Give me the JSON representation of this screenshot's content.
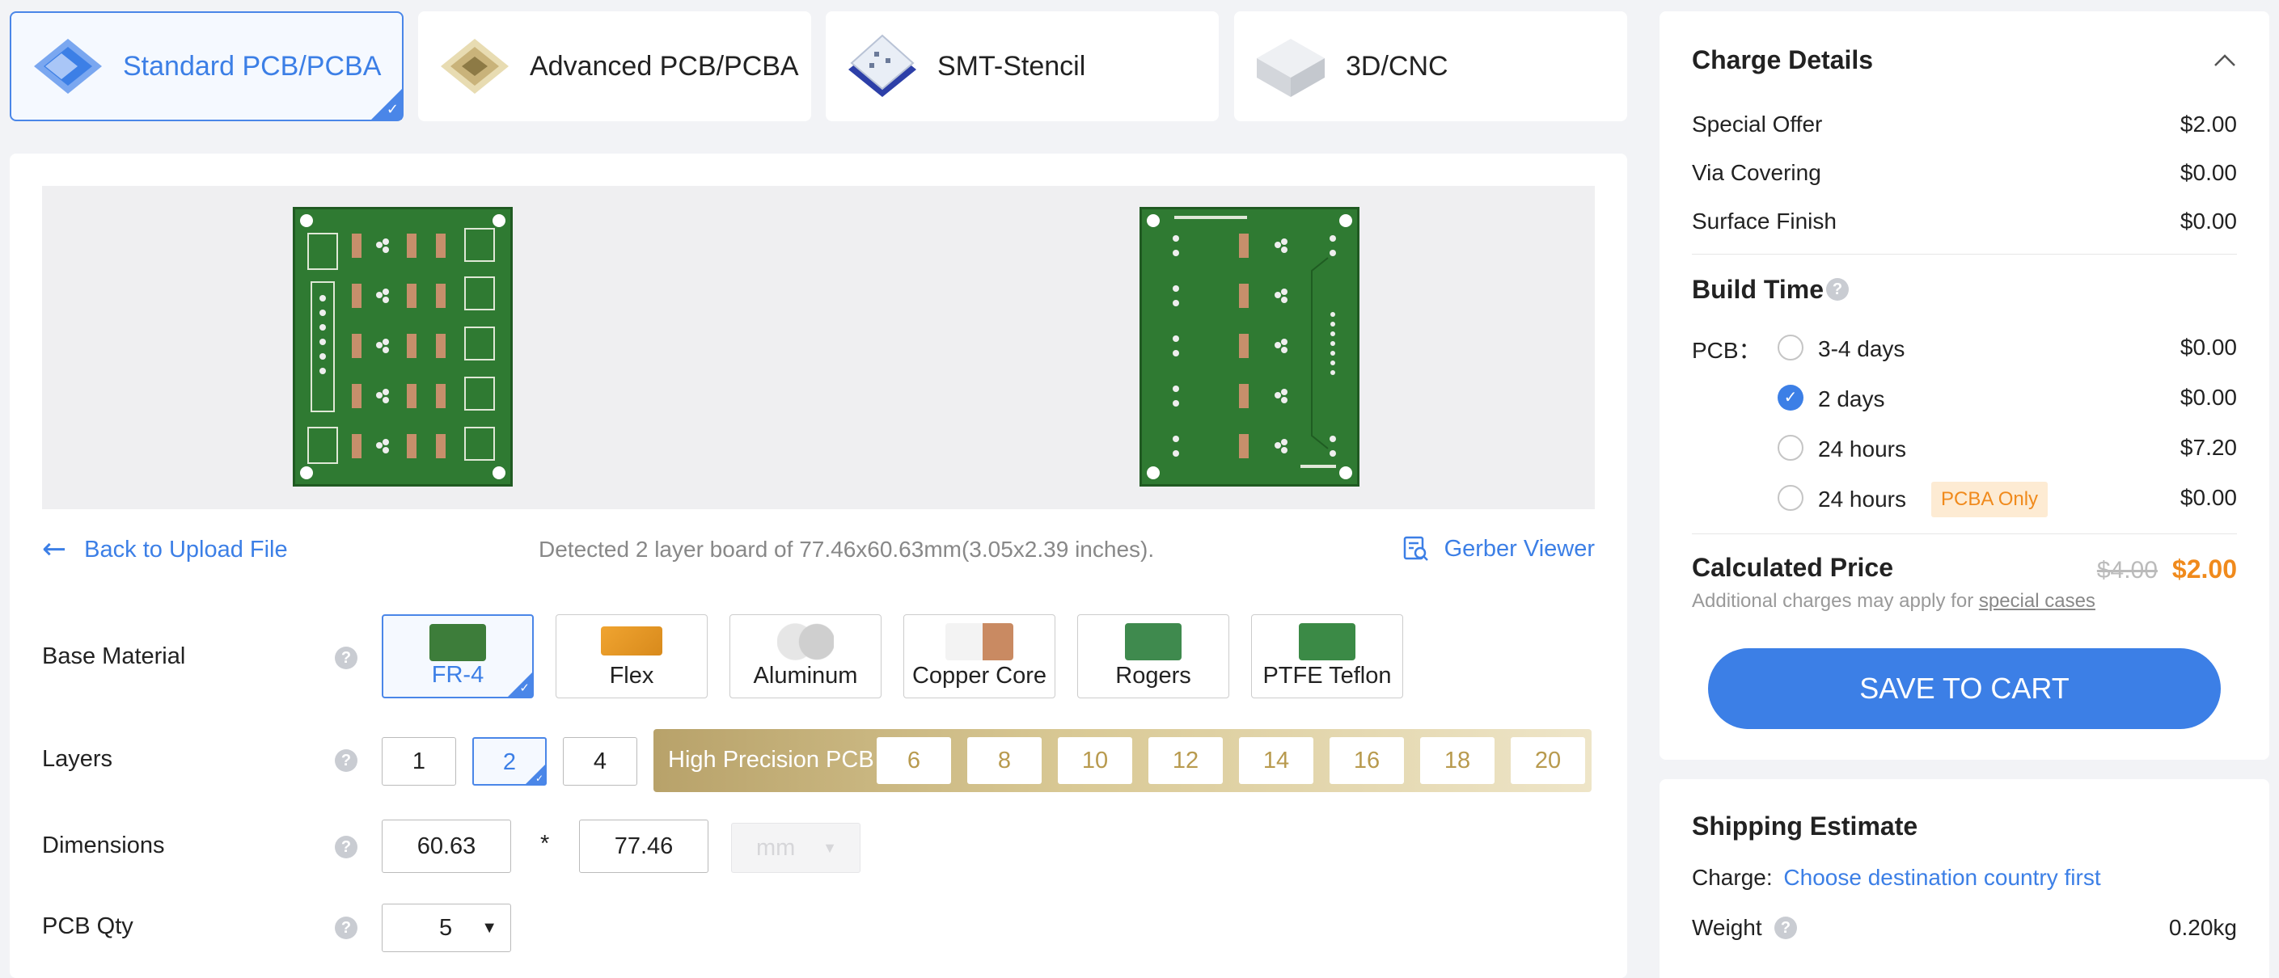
{
  "tabs": [
    {
      "label": "Standard PCB/PCBA",
      "icon": "standard-pcb-icon",
      "active": true
    },
    {
      "label": "Advanced PCB/PCBA",
      "icon": "advanced-pcb-icon",
      "active": false
    },
    {
      "label": "SMT-Stencil",
      "icon": "smt-stencil-icon",
      "active": false
    },
    {
      "label": "3D/CNC",
      "icon": "3d-cnc-icon",
      "active": false
    }
  ],
  "file": {
    "back_label": "Back to Upload File",
    "detected_text": "Detected 2 layer board of 77.46x60.63mm(3.05x2.39 inches).",
    "gerber_label": "Gerber Viewer"
  },
  "form": {
    "base_material": {
      "label": "Base Material",
      "options": [
        {
          "label": "FR-4",
          "active": true
        },
        {
          "label": "Flex",
          "active": false
        },
        {
          "label": "Aluminum",
          "active": false
        },
        {
          "label": "Copper Core",
          "active": false
        },
        {
          "label": "Rogers",
          "active": false
        },
        {
          "label": "PTFE Teflon",
          "active": false
        }
      ]
    },
    "layers": {
      "label": "Layers",
      "options": [
        "1",
        "2",
        "4"
      ],
      "selected": "2",
      "high_precision_label": "High Precision PCB",
      "high_precision_options": [
        "6",
        "8",
        "10",
        "12",
        "14",
        "16",
        "18",
        "20"
      ]
    },
    "dimensions": {
      "label": "Dimensions",
      "width": "60.63",
      "separator": "*",
      "height": "77.46",
      "unit": "mm"
    },
    "qty": {
      "label": "PCB Qty",
      "value": "5"
    }
  },
  "charge": {
    "title": "Charge Details",
    "items": [
      {
        "label": "Special Offer",
        "value": "$2.00"
      },
      {
        "label": "Via Covering",
        "value": "$0.00"
      },
      {
        "label": "Surface Finish",
        "value": "$0.00"
      }
    ],
    "build_time_title": "Build Time",
    "pcb_label": "PCB：",
    "build_options": [
      {
        "label": "3-4 days",
        "price": "$0.00",
        "checked": false,
        "tag": ""
      },
      {
        "label": "2 days",
        "price": "$0.00",
        "checked": true,
        "tag": ""
      },
      {
        "label": "24 hours",
        "price": "$7.20",
        "checked": false,
        "tag": ""
      },
      {
        "label": "24 hours",
        "price": "$0.00",
        "checked": false,
        "tag": "PCBA Only"
      }
    ],
    "calculated_label": "Calculated Price",
    "old_price": "$4.00",
    "new_price": "$2.00",
    "note_prefix": "Additional charges may apply for ",
    "note_link": "special cases",
    "save_button": "SAVE TO CART"
  },
  "shipping": {
    "title": "Shipping Estimate",
    "charge_label": "Charge:",
    "charge_link": "Choose destination country first",
    "weight_label": "Weight",
    "weight_value": "0.20kg"
  },
  "colors": {
    "accent": "#3c7fe6",
    "price_orange": "#f08a1c",
    "pcb_green": "#2f7a32",
    "gold": "#c8b27a"
  }
}
